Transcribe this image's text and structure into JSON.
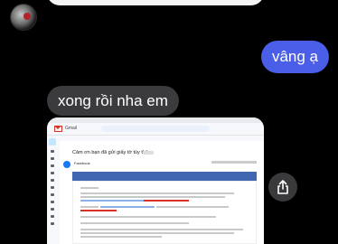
{
  "chat": {
    "sent_message": "vâng ạ",
    "received_message": "xong rồi nha em"
  },
  "attachment": {
    "gmail_label": "Gmail",
    "email_subject": "Cảm ơn bạn đã gửi giấy tờ tùy thân",
    "sender_name": "Facebook",
    "brand_color": "#1877f2"
  },
  "actions": {
    "share_icon": "share-icon"
  },
  "colors": {
    "sent_bubble": "#4a5ee8",
    "received_bubble": "#3b3b3d",
    "background": "#000000"
  }
}
